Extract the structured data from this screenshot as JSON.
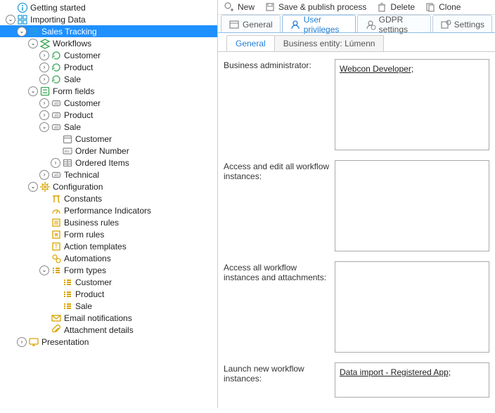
{
  "toolbar": {
    "new": "New",
    "save_publish": "Save & publish process",
    "delete": "Delete",
    "clone": "Clone"
  },
  "main_tabs": {
    "general": "General",
    "user_priv": "User privileges",
    "gdpr": "GDPR settings",
    "settings": "Settings"
  },
  "sub_tabs": {
    "general": "General",
    "business_entity": "Business entity: Lúmenn"
  },
  "fields": {
    "business_admin": {
      "label": "Business administrator:",
      "value": "Webcon Developer;"
    },
    "access_edit": {
      "label": "Access and edit all workflow instances:",
      "value": ""
    },
    "access_all": {
      "label": "Access all workflow instances and attachments:",
      "value": ""
    },
    "launch_new": {
      "label": "Launch new workflow instances:",
      "value": "Data import - Registered App;"
    }
  },
  "tree": {
    "getting_started": "Getting started",
    "importing_data": "Importing Data",
    "sales_tracking": "Sales Tracking",
    "workflows": "Workflows",
    "wf_customer": "Customer",
    "wf_product": "Product",
    "wf_sale": "Sale",
    "form_fields": "Form fields",
    "ff_customer": "Customer",
    "ff_product": "Product",
    "ff_sale": "Sale",
    "ff_sale_customer": "Customer",
    "ff_sale_order": "Order Number",
    "ff_sale_items": "Ordered Items",
    "ff_technical": "Technical",
    "configuration": "Configuration",
    "constants": "Constants",
    "perf_ind": "Performance Indicators",
    "business_rules": "Business rules",
    "form_rules": "Form rules",
    "action_templates": "Action templates",
    "automations": "Automations",
    "form_types": "Form types",
    "ft_customer": "Customer",
    "ft_product": "Product",
    "ft_sale": "Sale",
    "email_notif": "Email notifications",
    "attach_details": "Attachment details",
    "presentation": "Presentation"
  }
}
